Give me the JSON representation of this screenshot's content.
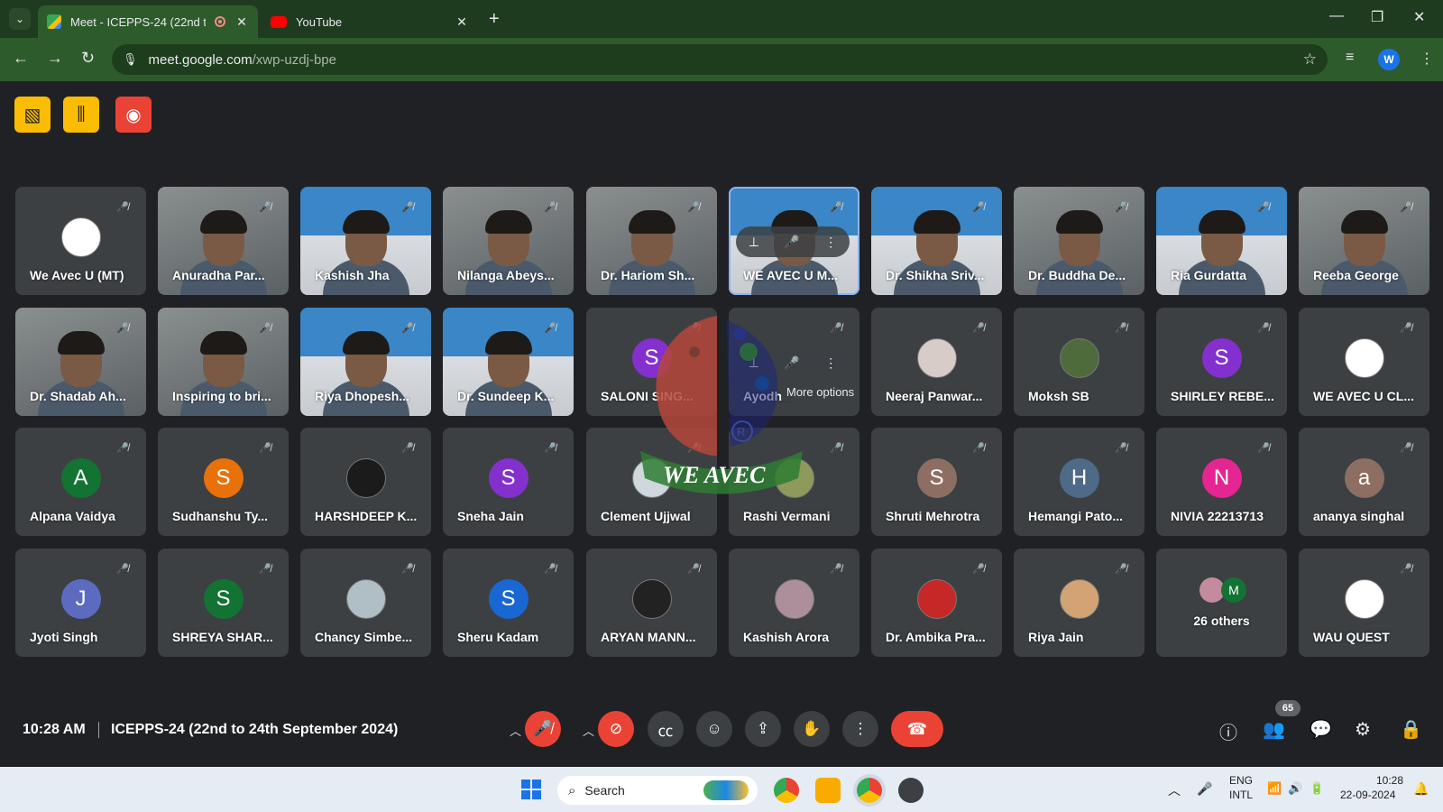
{
  "browser": {
    "tabs": [
      {
        "title": "Meet - ICEPPS-24 (22nd to",
        "active": true,
        "recording": true
      },
      {
        "title": "YouTube",
        "active": false
      }
    ],
    "url_host": "meet.google.com",
    "url_path": "/xwp-uzdj-bpe",
    "profile_initial": "W"
  },
  "participants_row1": [
    {
      "name": "We Avec U (MT)"
    },
    {
      "name": "Anuradha Par..."
    },
    {
      "name": "Kashish Jha"
    },
    {
      "name": "Nilanga Abeys..."
    },
    {
      "name": "Dr. Hariom Sh..."
    },
    {
      "name": "WE AVEC U M..."
    },
    {
      "name": "Dr. Shikha Sriv..."
    },
    {
      "name": "Dr. Buddha De..."
    },
    {
      "name": "Ria Gurdatta"
    },
    {
      "name": "Reeba George"
    }
  ],
  "participants_row2": [
    {
      "name": "Dr. Shadab Ah..."
    },
    {
      "name": "Inspiring to bri..."
    },
    {
      "name": "Riya Dhopesh..."
    },
    {
      "name": "Dr. Sundeep K..."
    },
    {
      "name": "SALONI SING...",
      "initial": "S",
      "color": "#8430ce"
    },
    {
      "name": "Ayodhik"
    },
    {
      "name": "Neeraj Panwar..."
    },
    {
      "name": "Moksh SB"
    },
    {
      "name": "SHIRLEY REBE...",
      "initial": "S",
      "color": "#8430ce"
    },
    {
      "name": "WE AVEC U CL..."
    }
  ],
  "participants_row3": [
    {
      "name": "Alpana Vaidya",
      "initial": "A",
      "color": "#137333"
    },
    {
      "name": "Sudhanshu Ty...",
      "initial": "S",
      "color": "#e8710a"
    },
    {
      "name": "HARSHDEEP K..."
    },
    {
      "name": "Sneha Jain",
      "initial": "S",
      "color": "#8430ce"
    },
    {
      "name": "Clement Ujjwal"
    },
    {
      "name": "Rashi Vermani"
    },
    {
      "name": "Shruti Mehrotra",
      "initial": "S",
      "color": "#8d6e63"
    },
    {
      "name": "Hemangi Pato...",
      "initial": "H",
      "color": "#4f6a86"
    },
    {
      "name": "NIVIA 22213713",
      "initial": "N",
      "color": "#e52592"
    },
    {
      "name": "ananya singhal",
      "initial": "a",
      "color": "#8d6e63"
    }
  ],
  "participants_row4": [
    {
      "name": "Jyoti Singh",
      "initial": "J",
      "color": "#5c6bc0"
    },
    {
      "name": "SHREYA SHAR...",
      "initial": "S",
      "color": "#137333"
    },
    {
      "name": "Chancy Simbe..."
    },
    {
      "name": "Sheru Kadam",
      "initial": "S",
      "color": "#1967d2"
    },
    {
      "name": "ARYAN MANN..."
    },
    {
      "name": "Kashish Arora"
    },
    {
      "name": "Dr. Ambika Pra..."
    },
    {
      "name": "Riya Jain"
    },
    {
      "name": "26 others"
    },
    {
      "name": "WAU QUEST"
    }
  ],
  "others_avatar_initial": "M",
  "tooltip": "More options",
  "watermark_text": "WE AVEC",
  "bottom_bar": {
    "time": "10:28 AM",
    "meeting_title": "ICEPPS-24 (22nd to 24th September 2024)",
    "participant_count": "65"
  },
  "taskbar": {
    "search_placeholder": "Search",
    "lang_line1": "ENG",
    "lang_line2": "INTL",
    "clock_time": "10:28",
    "clock_date": "22-09-2024"
  }
}
